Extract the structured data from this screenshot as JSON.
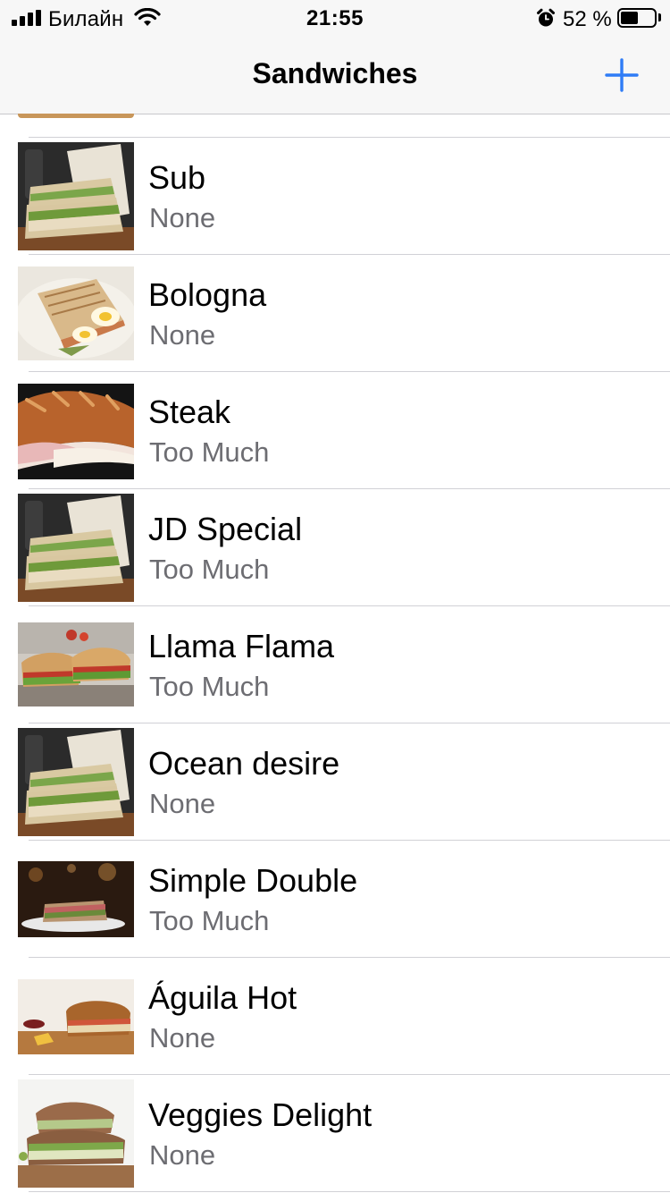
{
  "status_bar": {
    "carrier": "Билайн",
    "time": "21:55",
    "battery_text": "52 %",
    "battery_level": 0.52
  },
  "nav": {
    "title": "Sandwiches",
    "add_icon": "plus-icon",
    "accent_color": "#2f7cf6"
  },
  "sandwiches": [
    {
      "name": "Sub",
      "detail": "None",
      "image": "club-sandwich-photo"
    },
    {
      "name": "Bologna",
      "detail": "None",
      "image": "panini-egg-photo"
    },
    {
      "name": "Steak",
      "detail": "Too Much",
      "image": "baguette-photo"
    },
    {
      "name": "JD Special",
      "detail": "Too Much",
      "image": "club-sandwich-photo"
    },
    {
      "name": "Llama Flama",
      "detail": "Too Much",
      "image": "ciabatta-photo"
    },
    {
      "name": "Ocean desire",
      "detail": "None",
      "image": "club-sandwich-photo"
    },
    {
      "name": "Simple Double",
      "detail": "Too Much",
      "image": "dark-plate-photo"
    },
    {
      "name": "Águila Hot",
      "detail": "None",
      "image": "grain-roll-photo"
    },
    {
      "name": "Veggies Delight",
      "detail": "None",
      "image": "veggie-sprouts-photo"
    }
  ]
}
